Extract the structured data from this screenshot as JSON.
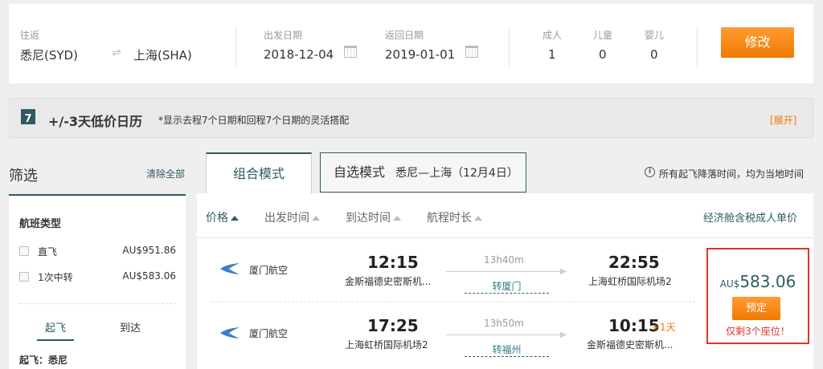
{
  "search": {
    "route_label": "往返",
    "from": "悉尼(SYD)",
    "to": "上海(SHA)",
    "depart_label": "出发日期",
    "depart_date": "2018-12-04",
    "return_label": "返回日期",
    "return_date": "2019-01-01",
    "passengers": [
      {
        "label": "成人",
        "count": "1"
      },
      {
        "label": "儿童",
        "count": "0"
      },
      {
        "label": "婴儿",
        "count": "0"
      }
    ],
    "modify_label": "修改"
  },
  "lowbar": {
    "icon_text": "7",
    "title": "+/-3天低价日历",
    "note": "*显示去程7个日期和回程7个日期的灵活搭配",
    "expand": "[展开]"
  },
  "filter": {
    "title": "筛选",
    "clear": "清除全部",
    "section_title": "航班类型",
    "options": [
      {
        "label": "直飞",
        "price": "AU$951.86"
      },
      {
        "label": "1次中转",
        "price": "AU$583.06"
      }
    ],
    "tabs": [
      "起飞",
      "到达"
    ],
    "depart_city": "起飞：悉尼"
  },
  "tabs": {
    "combo": "组合模式",
    "free": "自选模式",
    "free_route": "悉尼—上海（12月4日）"
  },
  "timezone_note": "所有起飞降落时间，均为当地时间",
  "sort": {
    "price": "价格",
    "depart": "出发时间",
    "arrive": "到达时间",
    "duration": "航程时长",
    "right_note": "经济舱含税成人单价"
  },
  "flights": [
    {
      "airline": "厦门航空",
      "dep_time": "12:15",
      "dep_airport": "金斯福德史密斯机...",
      "duration": "13h40m",
      "transfer": "转厦门",
      "arr_time": "22:55",
      "arr_airport": "上海虹桥国际机场2",
      "day_offset": ""
    },
    {
      "airline": "厦门航空",
      "dep_time": "17:25",
      "dep_airport": "上海虹桥国际机场2",
      "duration": "13h50m",
      "transfer": "转福州",
      "arr_time": "10:15",
      "arr_airport": "金斯福德史密斯机...",
      "day_offset": "+1天"
    }
  ],
  "price_box": {
    "currency": "AU$",
    "amount": "583.06",
    "book_label": "预定",
    "seats_note": "仅剩3个座位！"
  },
  "colors": {
    "accent": "#2e5b62",
    "orange": "#f07a00",
    "price_red": "#d9372a"
  }
}
